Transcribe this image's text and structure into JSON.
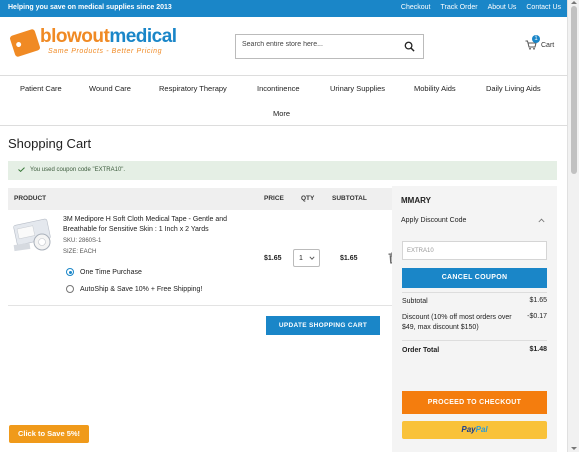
{
  "topbar": {
    "tagline": "Helping you save on medical supplies since 2013",
    "links": [
      "Checkout",
      "Track Order",
      "About Us",
      "Contact Us"
    ]
  },
  "logo": {
    "brand_part1": "blowout",
    "brand_part2": "medical",
    "slogan": "Same Products - Better Pricing"
  },
  "search": {
    "placeholder": "Search entire store here..."
  },
  "cart": {
    "label": "Cart",
    "count": "1"
  },
  "nav": {
    "items": [
      "Patient Care",
      "Wound Care",
      "Respiratory Therapy",
      "Incontinence",
      "Urinary Supplies",
      "Mobility Aids",
      "Daily Living Aids",
      "More"
    ]
  },
  "page_title": "Shopping Cart",
  "message": "You used coupon code \"EXTRA10\".",
  "table": {
    "headers": {
      "product": "PRODUCT",
      "price": "PRICE",
      "qty": "QTY",
      "subtotal": "SUBTOTAL"
    }
  },
  "item": {
    "name": "3M Medipore H Soft Cloth Medical Tape - Gentle and Breathable for Sensitive Skin : 1 Inch x 2 Yards",
    "sku": "SKU: 2860S-1",
    "size": "SIZE: EACH",
    "price": "$1.65",
    "qty": "1",
    "subtotal": "$1.65",
    "options": [
      "One Time Purchase",
      "AutoShip & Save 10% + Free Shipping!"
    ],
    "selected_option": 0
  },
  "update_button": "UPDATE SHOPPING CART",
  "summary": {
    "title": "MMARY",
    "discount_heading": "Apply Discount Code",
    "coupon_value": "EXTRA10",
    "cancel_button": "CANCEL COUPON",
    "subtotal_label": "Subtotal",
    "subtotal_value": "$1.65",
    "discount_label": "Discount (10% off most orders over $49, max discount $150)",
    "discount_value": "-$0.17",
    "total_label": "Order Total",
    "total_value": "$1.48",
    "checkout_button": "PROCEED TO CHECKOUT",
    "paypal_part1": "Pay",
    "paypal_part2": "Pal"
  },
  "save_button": "Click to Save 5%!",
  "colors": {
    "brand_blue": "#1a86c8",
    "brand_orange": "#f08a24",
    "checkout_orange": "#f47d0e",
    "paypal_yellow": "#f9c23a"
  }
}
